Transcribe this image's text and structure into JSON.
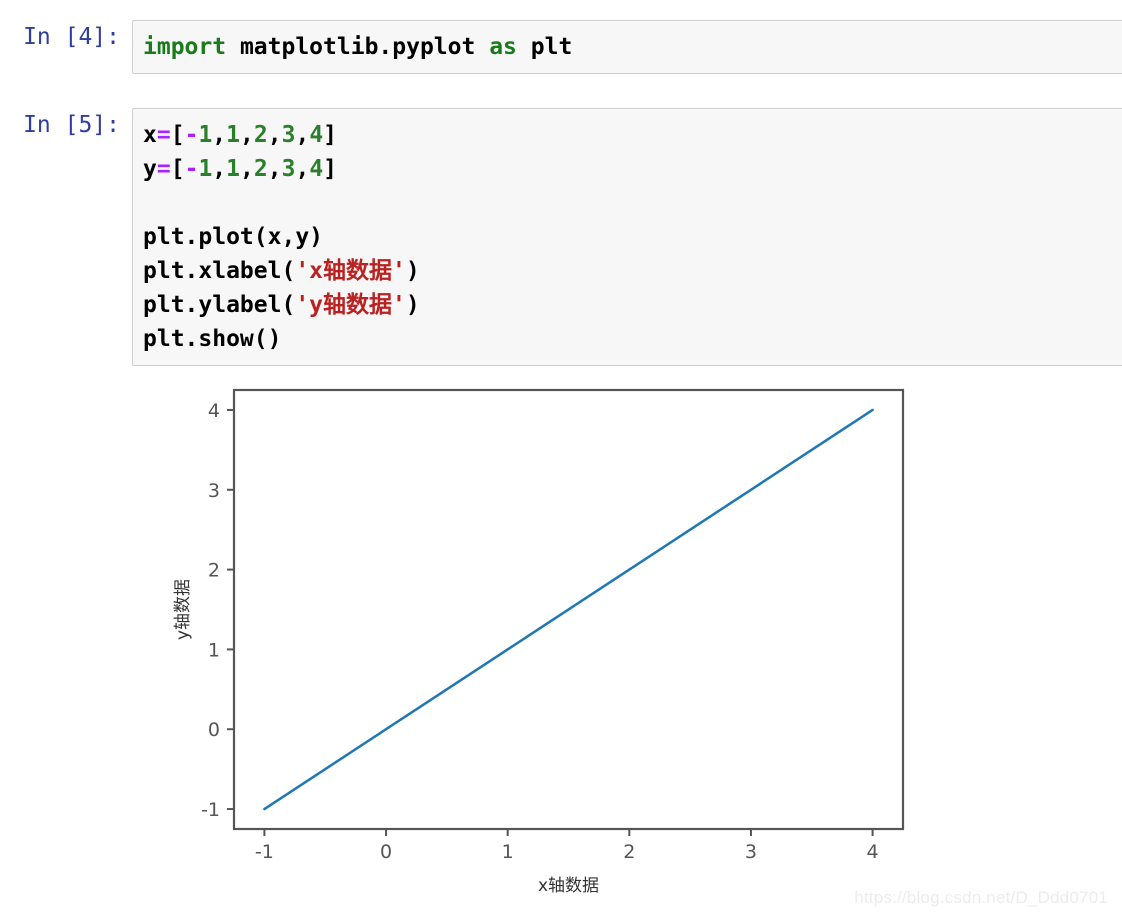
{
  "notebook": {
    "cells": [
      {
        "prompt": "In [4]:",
        "lines": [
          [
            {
              "t": "import",
              "c": "kw"
            },
            {
              "t": " matplotlib.pyplot ",
              "c": "plain"
            },
            {
              "t": "as",
              "c": "kw"
            },
            {
              "t": " plt",
              "c": "plain"
            }
          ]
        ]
      },
      {
        "prompt": "In [5]:",
        "lines": [
          [
            {
              "t": "x",
              "c": "plain"
            },
            {
              "t": "=",
              "c": "op"
            },
            {
              "t": "[",
              "c": "plain"
            },
            {
              "t": "-",
              "c": "op"
            },
            {
              "t": "1",
              "c": "num"
            },
            {
              "t": ",",
              "c": "plain"
            },
            {
              "t": "1",
              "c": "num"
            },
            {
              "t": ",",
              "c": "plain"
            },
            {
              "t": "2",
              "c": "num"
            },
            {
              "t": ",",
              "c": "plain"
            },
            {
              "t": "3",
              "c": "num"
            },
            {
              "t": ",",
              "c": "plain"
            },
            {
              "t": "4",
              "c": "num"
            },
            {
              "t": "]",
              "c": "plain"
            }
          ],
          [
            {
              "t": "y",
              "c": "plain"
            },
            {
              "t": "=",
              "c": "op"
            },
            {
              "t": "[",
              "c": "plain"
            },
            {
              "t": "-",
              "c": "op"
            },
            {
              "t": "1",
              "c": "num"
            },
            {
              "t": ",",
              "c": "plain"
            },
            {
              "t": "1",
              "c": "num"
            },
            {
              "t": ",",
              "c": "plain"
            },
            {
              "t": "2",
              "c": "num"
            },
            {
              "t": ",",
              "c": "plain"
            },
            {
              "t": "3",
              "c": "num"
            },
            {
              "t": ",",
              "c": "plain"
            },
            {
              "t": "4",
              "c": "num"
            },
            {
              "t": "]",
              "c": "plain"
            }
          ],
          [],
          [
            {
              "t": "plt.plot(x,y)",
              "c": "plain"
            }
          ],
          [
            {
              "t": "plt.xlabel(",
              "c": "plain"
            },
            {
              "t": "'x轴数据'",
              "c": "str"
            },
            {
              "t": ")",
              "c": "plain"
            }
          ],
          [
            {
              "t": "plt.ylabel(",
              "c": "plain"
            },
            {
              "t": "'y轴数据'",
              "c": "str"
            },
            {
              "t": ")",
              "c": "plain"
            }
          ],
          [
            {
              "t": "plt.show()",
              "c": "plain"
            }
          ]
        ]
      }
    ]
  },
  "chart_data": {
    "type": "line",
    "title": "",
    "xlabel": "x轴数据",
    "ylabel": "y轴数据",
    "x": [
      -1,
      1,
      2,
      3,
      4
    ],
    "y": [
      -1,
      1,
      2,
      3,
      4
    ],
    "series": [
      {
        "name": "",
        "color": "#1f77b4",
        "x": [
          -1,
          1,
          2,
          3,
          4
        ],
        "y": [
          -1,
          1,
          2,
          3,
          4
        ]
      }
    ],
    "xticks": [
      "-1",
      "0",
      "1",
      "2",
      "3",
      "4"
    ],
    "xtick_values": [
      -1,
      0,
      1,
      2,
      3,
      4
    ],
    "yticks": [
      "-1",
      "0",
      "1",
      "2",
      "3",
      "4"
    ],
    "ytick_values": [
      -1,
      0,
      1,
      2,
      3,
      4
    ],
    "xlim": [
      -1.25,
      4.25
    ],
    "ylim": [
      -1.25,
      4.25
    ],
    "grid": false,
    "legend": "none",
    "line_color": "#1f77b4",
    "line_width": 2.5,
    "spine_color": "#555555"
  },
  "watermark": {
    "text": "https://blog.csdn.net/D_Ddd0701",
    "color": "#ececec"
  }
}
